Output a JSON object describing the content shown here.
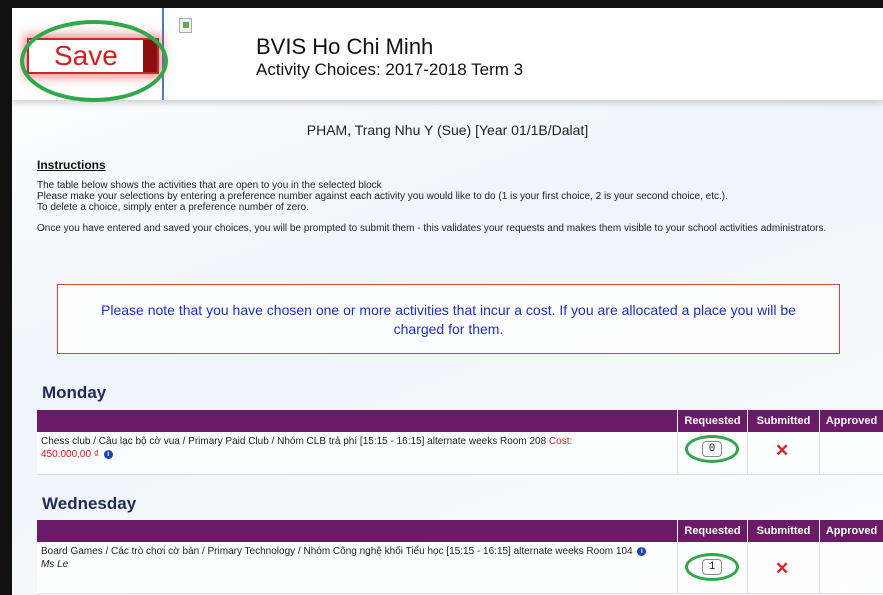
{
  "header": {
    "save_label": "Save",
    "school_name": "BVIS Ho Chi Minh",
    "activity_title": "Activity Choices: 2017-2018 Term 3"
  },
  "student": "PHAM, Trang Nhu Y (Sue) [Year 01/1B/Dalat]",
  "instructions": {
    "heading": "Instructions",
    "line1": "The table below shows the activities that are open to you in the selected block",
    "line2": "Please make your selections by entering a preference number against each activity you would like to do (1 is your first choice, 2 is your second choice, etc.).",
    "line3": "To delete a choice, simply enter a preference number of zero.",
    "line4": "Once you have entered and saved your choices, you will be prompted to submit them - this validates your requests and makes them visible to your school activities administrators."
  },
  "notice": "Please note that you have chosen one or more activities that incur a cost. If you are allocated a place you will be charged for them.",
  "columns": {
    "requested": "Requested",
    "submitted": "Submitted",
    "approved": "Approved"
  },
  "days": [
    {
      "name": "Monday",
      "activity": "Chess club / Câu lạc bộ cờ vua / Primary Paid Club / Nhóm CLB trả phí [15:15 - 16:15] alternate weeks Room 208",
      "cost_label": "Cost:",
      "cost_value": "450.000,00 ₫",
      "requested_value": "0",
      "submitted_icon": "red-x"
    },
    {
      "name": "Wednesday",
      "activity": "Board Games / Các trò chơi cờ bàn / Primary Technology / Nhóm Công nghệ khối Tiểu học [15:15 - 16:15] alternate weeks Room 104",
      "teacher": "Ms Le",
      "requested_value": "1",
      "submitted_icon": "red-x"
    }
  ],
  "colors": {
    "table_header": "#6a1a66",
    "save_red": "#d32020",
    "notice_blue": "#1a2fd0",
    "highlight_green": "#2fa84a"
  }
}
